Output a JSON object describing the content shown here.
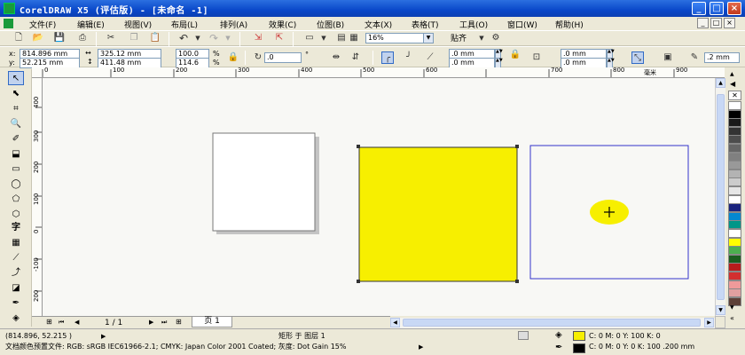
{
  "window": {
    "title": "CorelDRAW X5 (评估版) - [未命名 -1]",
    "buttons": [
      "_",
      "□",
      "×"
    ]
  },
  "menu": {
    "items": [
      "文件(F)",
      "编辑(E)",
      "视图(V)",
      "布局(L)",
      "排列(A)",
      "效果(C)",
      "位图(B)",
      "文本(X)",
      "表格(T)",
      "工具(O)",
      "窗口(W)",
      "帮助(H)"
    ],
    "mdi_buttons": [
      "_",
      "□",
      "×"
    ]
  },
  "standard_toolbar": {
    "zoom_value": "16%",
    "snap_label": "贴齐"
  },
  "property_bar": {
    "x_label": "x:",
    "x_value": "814.896 mm",
    "y_label": "y:",
    "y_value": "52.215 mm",
    "width_value": "325.12 mm",
    "height_value": "411.48 mm",
    "scale_x": "100.0",
    "scale_y": "114.6",
    "percent": "%",
    "rotation_value": ".0",
    "degree": "°",
    "corner_top": ".0 mm",
    "corner_bottom": ".0 mm",
    "corner_top_right": ".0 mm",
    "corner_bottom_right": ".0 mm",
    "outline_width": ".2 mm"
  },
  "rulers": {
    "horizontal": [
      "0",
      "100",
      "200",
      "300",
      "400",
      "500",
      "600",
      "700",
      "800",
      "900"
    ],
    "vertical": [
      "400",
      "300",
      "200",
      "100",
      "0",
      "-100",
      "200"
    ],
    "unit": "毫米"
  },
  "page_nav": {
    "counter": "1 / 1",
    "tab": "页 1"
  },
  "status": {
    "coords": "(814.896, 52.215 )",
    "object_info": "矩形 于 图层 1",
    "fill_info": "C: 0 M: 0 Y: 100 K: 0",
    "outline_info": "C: 0 M: 0 Y: 0 K: 100  .200 mm",
    "color_profile": "文档颜色预置文件: RGB: sRGB IEC61966-2.1; CMYK: Japan Color 2001 Coated; 灰度: Dot Gain 15%"
  },
  "colors": {
    "yellow": "#f7ef00",
    "selection_blue": "#3333cc",
    "titlebar": "#0a48c9"
  },
  "palette_colors": [
    "#ffffff",
    "#000000",
    "#1a1a1a",
    "#333333",
    "#4d4d4d",
    "#666666",
    "#808080",
    "#999999",
    "#b3b3b3",
    "#cccccc",
    "#e6e6e6",
    "#ffffff",
    "#1a237e",
    "#0288d1",
    "#009688",
    "#ffffff",
    "#ffff00",
    "#4caf50",
    "#1b5e20",
    "#b71c1c",
    "#d32f2f",
    "#ef9a9a",
    "#e0a0a0",
    "#5d4037"
  ]
}
